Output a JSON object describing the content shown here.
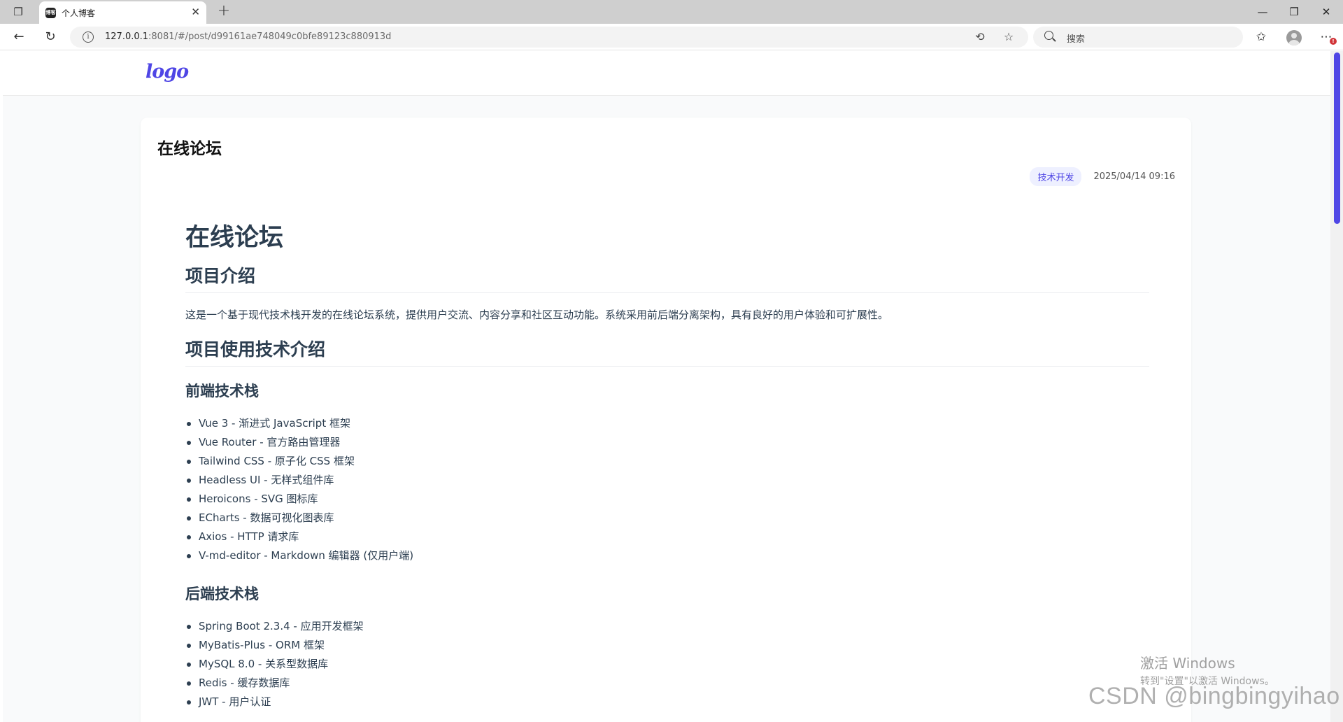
{
  "browser": {
    "tab_title": "个人博客",
    "tab_favicon_text": "博客",
    "url_host": "127.0.0.1",
    "url_rest": ":8081/#/post/d99161ae748049c0bfe89123c880913d",
    "search_placeholder": "搜索"
  },
  "site": {
    "logo": "logo"
  },
  "post": {
    "title": "在线论坛",
    "category": "技术开发",
    "date": "2025/04/14 09:16"
  },
  "content": {
    "h1": "在线论坛",
    "intro_heading": "项目介绍",
    "intro_text": "这是一个基于现代技术栈开发的在线论坛系统，提供用户交流、内容分享和社区互动功能。系统采用前后端分离架构，具有良好的用户体验和可扩展性。",
    "tech_heading": "项目使用技术介绍",
    "frontend_heading": "前端技术栈",
    "frontend_items": [
      "Vue 3 - 渐进式 JavaScript 框架",
      "Vue Router - 官方路由管理器",
      "Tailwind CSS - 原子化 CSS 框架",
      "Headless UI - 无样式组件库",
      "Heroicons - SVG 图标库",
      "ECharts - 数据可视化图表库",
      "Axios - HTTP 请求库",
      "V-md-editor - Markdown 编辑器 (仅用户端)"
    ],
    "backend_heading": "后端技术栈",
    "backend_items": [
      "Spring Boot 2.3.4 - 应用开发框架",
      "MyBatis-Plus - ORM 框架",
      "MySQL 8.0 - 关系型数据库",
      "Redis - 缓存数据库",
      "JWT - 用户认证"
    ]
  },
  "overlay": {
    "windows_line1": "激活 Windows",
    "windows_line2": "转到\"设置\"以激活 Windows。",
    "csdn": "CSDN @bingbingyihao"
  },
  "colors": {
    "accent": "#4f46e5",
    "badge_bg": "#eef0ff",
    "text": "#2c3e50"
  }
}
